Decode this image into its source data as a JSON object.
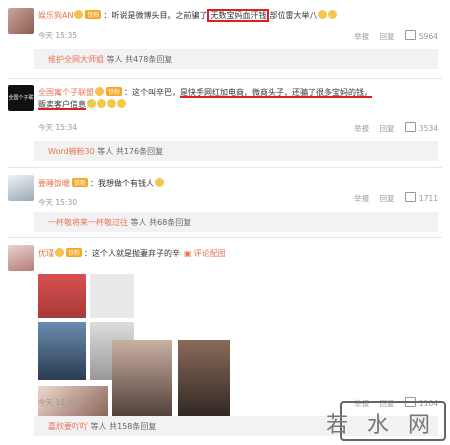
{
  "comments": [
    {
      "user": "娱乐狗AN",
      "badge": "铁粉",
      "text_pre": "：听说是微博头目。之前骗了",
      "text_hl": "无数宝妈血汗钱",
      "text_post": "部位雷大举八",
      "time": "今天 15:35",
      "report": "举报",
      "reply": "回复",
      "likes": "5964",
      "reply_link": "维护全网大师姐",
      "reply_rest": " 等人 共478条回复"
    },
    {
      "user": "全国寓个子联盟",
      "avatar_text": "全国个子联盟",
      "badge": "铁粉",
      "text_pre": "：这个叫辛巴，",
      "text_hl": "是快手网红加电商，微商头子，还骗了很多宝妈的钱，",
      "text_line2": "贩卖客户信息",
      "time": "今天 15:34",
      "report": "举报",
      "reply": "回复",
      "likes": "3534",
      "reply_link": "Word蜿粉30",
      "reply_rest": " 等人 共176条回复"
    },
    {
      "user": "要睡饭暖",
      "badge": "铁粉",
      "text": "：我想做个有钱人",
      "time": "今天 15:30",
      "report": "举报",
      "reply": "回复",
      "likes": "1711",
      "reply_link": "一杯敬将来一杯敬过往",
      "reply_rest": " 等人 共68条回复"
    },
    {
      "user": "优瑾",
      "badge": "铁粉",
      "text": "：这个人就是抛妻弃子的辛",
      "pic_comment": "评论配图",
      "time": "今天 15:42",
      "report": "举报",
      "reply": "回复",
      "likes": "1104",
      "reply_link": "嘉欣要吖吖",
      "reply_rest": " 等人 共158条回复"
    }
  ],
  "watermark": "若 水 网",
  "colors": {
    "username": "#eb7350",
    "highlight_box": "#e02020",
    "reply_bg": "#f2f2f5"
  },
  "icons": [
    "thumb-up-icon",
    "vip-icon",
    "emoji-icon",
    "picture-icon"
  ]
}
